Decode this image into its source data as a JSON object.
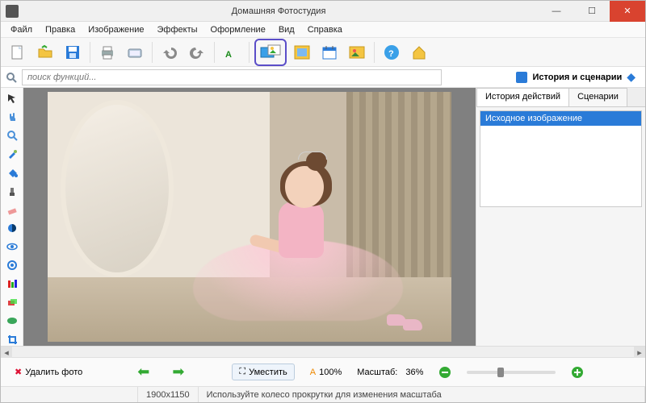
{
  "window": {
    "title": "Домашняя Фотостудия",
    "min": "—",
    "max": "☐",
    "close": "✕"
  },
  "menu": [
    "Файл",
    "Правка",
    "Изображение",
    "Эффекты",
    "Оформление",
    "Вид",
    "Справка"
  ],
  "toolbar_icons": {
    "new": "new-file-icon",
    "open": "open-icon",
    "save": "save-icon",
    "print": "print-icon",
    "scan": "scan-icon",
    "undo": "undo-icon",
    "redo": "redo-icon",
    "text": "text-icon",
    "frame": "combine-icon",
    "calendar": "calendar-icon",
    "postcard": "postcard-icon",
    "help": "help-icon",
    "home": "home-icon"
  },
  "search": {
    "placeholder": "поиск функций..."
  },
  "right": {
    "header": "История и сценарии",
    "tabs": [
      "История действий",
      "Сценарии"
    ],
    "history_item": "Исходное изображение"
  },
  "bottom": {
    "delete": "Удалить фото",
    "fit": "Уместить",
    "scale100": "100%",
    "scale_label": "Масштаб:",
    "scale_value": "36%"
  },
  "status": {
    "dims": "1900x1150",
    "hint": "Используйте колесо прокрутки для изменения масштаба"
  }
}
